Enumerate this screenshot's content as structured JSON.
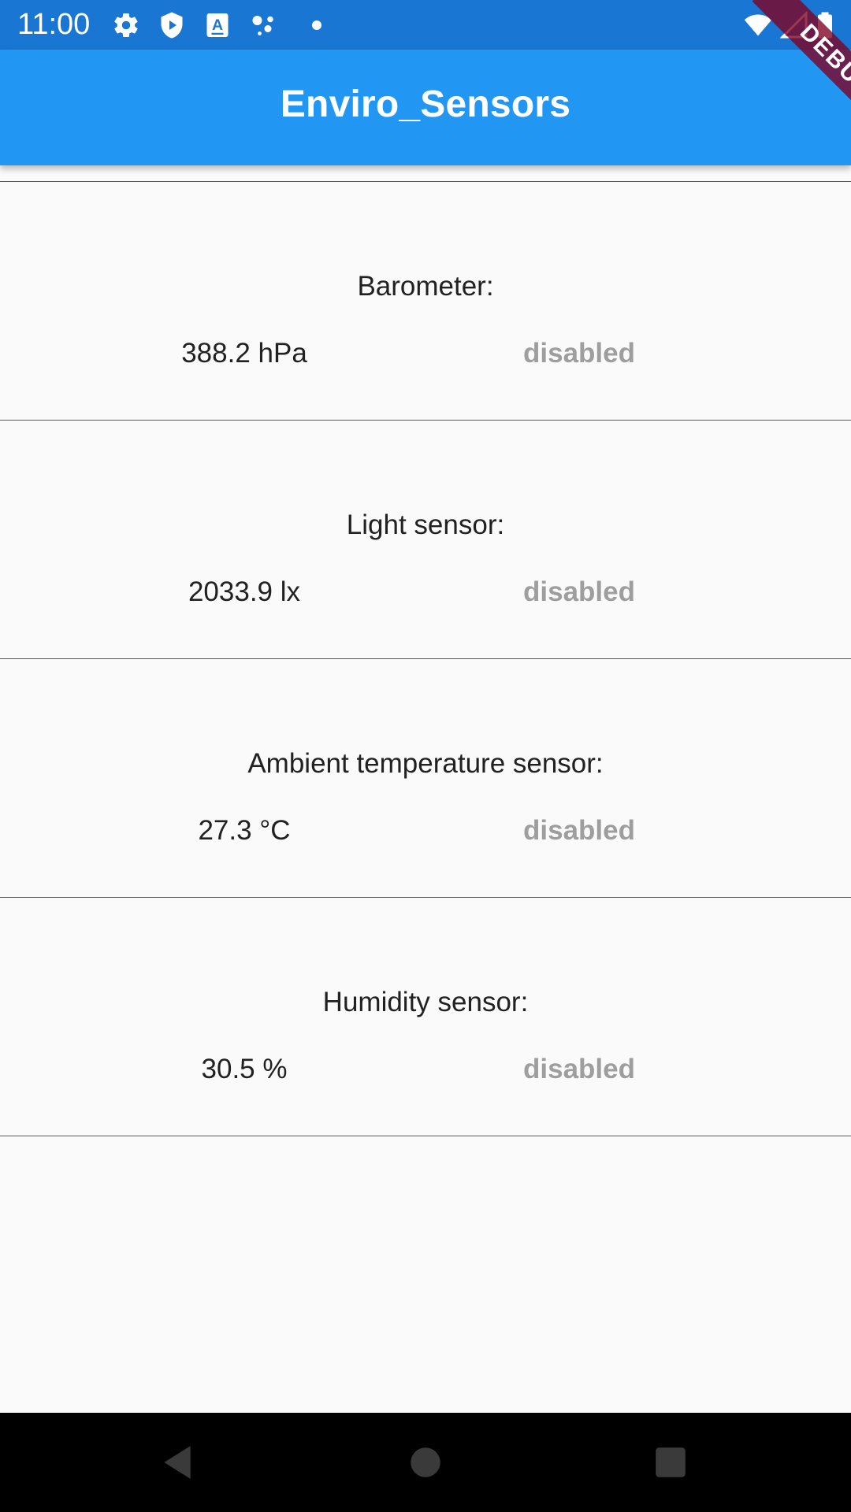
{
  "status_bar": {
    "time": "11:00",
    "icons": [
      "gear-icon",
      "shield-icon",
      "keyboard-a-icon",
      "assistant-dots-icon",
      "dot-icon",
      "wifi-icon",
      "signal-icon",
      "battery-icon"
    ]
  },
  "app_bar": {
    "title": "Enviro_Sensors",
    "color": "#2196f3"
  },
  "debug_banner": "DEBUG",
  "sensors": [
    {
      "label": "Barometer:",
      "value": "388.2 hPa",
      "status": "disabled"
    },
    {
      "label": "Light sensor:",
      "value": "2033.9 lx",
      "status": "disabled"
    },
    {
      "label": "Ambient temperature sensor:",
      "value": "27.3 °C",
      "status": "disabled"
    },
    {
      "label": "Humidity sensor:",
      "value": "30.5 %",
      "status": "disabled"
    }
  ],
  "nav_bar": {
    "buttons": [
      "back-triangle-icon",
      "home-circle-icon",
      "recents-square-icon"
    ]
  },
  "colors": {
    "status_bar": "#1976d2",
    "app_bar": "#2196f3",
    "status_text": "#9e9e9e",
    "debug_ribbon": "#800020"
  }
}
